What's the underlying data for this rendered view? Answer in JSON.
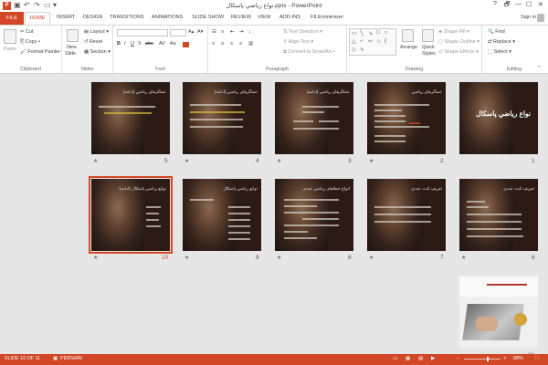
{
  "titlebar": {
    "app_icon": "P",
    "title": "نواع رياضي پاسکال.pptx - PowerPoint",
    "quick_access": [
      "save-icon",
      "undo-icon",
      "redo-icon",
      "start-from-beginning-icon",
      "customize-icon"
    ],
    "window_buttons": [
      "?",
      "🗗",
      "—",
      "☐",
      "✕"
    ]
  },
  "tabs": {
    "file": "FILE",
    "home": "HOME",
    "items": [
      "INSERT",
      "DESIGN",
      "TRANSITIONS",
      "ANIMATIONS",
      "SLIDE SHOW",
      "REVIEW",
      "VIEW",
      "ADD-INS",
      "FILEminimizer"
    ],
    "sign_in": "Sign in"
  },
  "ribbon": {
    "clipboard": {
      "label": "Clipboard",
      "paste": "Paste",
      "cut": "Cut",
      "copy": "Copy",
      "format_painter": "Format Painter"
    },
    "slides": {
      "label": "Slides",
      "new_slide": "New",
      "new_slide_2": "Slide",
      "layout": "Layout",
      "reset": "Reset",
      "section": "Section"
    },
    "font": {
      "label": "Font"
    },
    "paragraph": {
      "label": "Paragraph",
      "text_direction": "Text Direction",
      "align_text": "Align Text",
      "convert_smartart": "Convert to SmartArt"
    },
    "drawing": {
      "label": "Drawing",
      "arrange": "Arrange",
      "quick_styles": "Quick",
      "quick_styles_2": "Styles",
      "shape_fill": "Shape Fill",
      "shape_outline": "Shape Outline",
      "shape_effects": "Shape Effects"
    },
    "editing": {
      "label": "Editing",
      "find": "Find",
      "replace": "Replace",
      "select": "Select"
    }
  },
  "slides": [
    {
      "number": "1",
      "title": "نواع رياضي پاسکال",
      "kind": "title"
    },
    {
      "number": "2",
      "title": "عملگرهای رياضي",
      "kind": "text"
    },
    {
      "number": "3",
      "title": "عملگرهای رياضي (ادامه)",
      "kind": "text"
    },
    {
      "number": "4",
      "title": "عملگرهای رياضي (ادامه)",
      "kind": "text"
    },
    {
      "number": "5",
      "title": "عملگرهای رياضي (ادامه)",
      "kind": "text"
    },
    {
      "number": "6",
      "title": "تعريف ثابت عددی",
      "kind": "text"
    },
    {
      "number": "7",
      "title": "تعريف ثابت عددی",
      "kind": "text"
    },
    {
      "number": "8",
      "title": "انواع خطاهای رياضي عددی",
      "kind": "text"
    },
    {
      "number": "9",
      "title": "توابع رياضي پاسکال",
      "kind": "text"
    },
    {
      "number": "10",
      "title": "توابع رياضي پاسکال (ادامه)",
      "kind": "text"
    },
    {
      "number": "11",
      "title": "",
      "kind": "photo"
    }
  ],
  "status": {
    "slide_info": "SLIDE 10 OF 11",
    "language": "PERSIAN",
    "zoom": "88%",
    "zoom_minus": "−",
    "zoom_plus": "+"
  },
  "colors": {
    "accent": "#d24726",
    "slide_bg": "#2b1b14"
  }
}
